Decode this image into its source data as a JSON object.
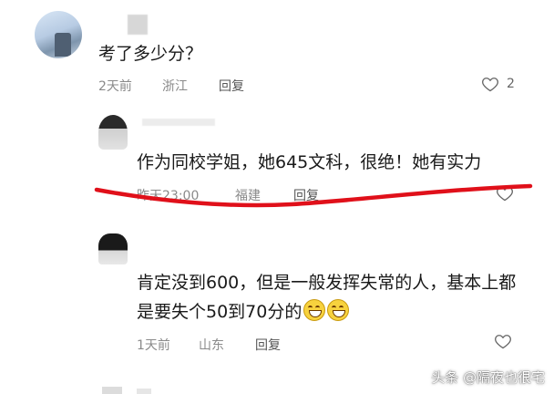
{
  "comments": [
    {
      "text": "考了多少分？",
      "time": "2天前",
      "location": "浙江",
      "reply_label": "回复",
      "likes": "2"
    },
    {
      "text": "作为同校学姐，她645文科，很绝！她有实力",
      "time": "昨天23:00",
      "location": "福建",
      "reply_label": "回复"
    },
    {
      "text_line1": "肯定没到600，但是一般发挥失常的人，基本上都",
      "text_line2": "是要失个50到70分的",
      "time": "1天前",
      "location": "山东",
      "reply_label": "回复"
    }
  ],
  "watermark": "头条 @隔夜也很宅",
  "colors": {
    "annotation_line": "#e0101a",
    "meta_text": "#8a8a8a"
  }
}
